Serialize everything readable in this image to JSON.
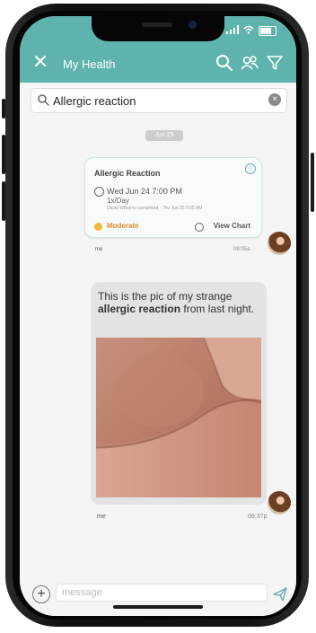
{
  "status_bar": {
    "time": "",
    "icons": [
      "signal-icon",
      "wifi-icon",
      "battery-icon"
    ]
  },
  "header": {
    "title": "My Health",
    "close_icon": "close-icon",
    "icons": [
      "search-icon",
      "people-icon",
      "filter-icon"
    ],
    "color": "#5fb3ad"
  },
  "search": {
    "value": "Allergic reaction",
    "placeholder": ""
  },
  "chat": {
    "date_chip": "Jun 25",
    "card": {
      "title": "Allergic Reaction",
      "datetime": "Wed Jun 24 7:00 PM",
      "frequency": "1x/Day",
      "completed_by": "David Williams completed - Thu Jun 25 9:05 AM",
      "severity": "Moderate",
      "severity_color": "#e08a2a",
      "view_chart": "View Chart",
      "sender": "me",
      "time": "09:05a"
    },
    "message": {
      "text_before": "This is the pic of my strange ",
      "text_bold": "allergic reaction",
      "text_after": " from last night.",
      "sender": "me",
      "time": "08:37p"
    }
  },
  "composer": {
    "placeholder": "message"
  }
}
